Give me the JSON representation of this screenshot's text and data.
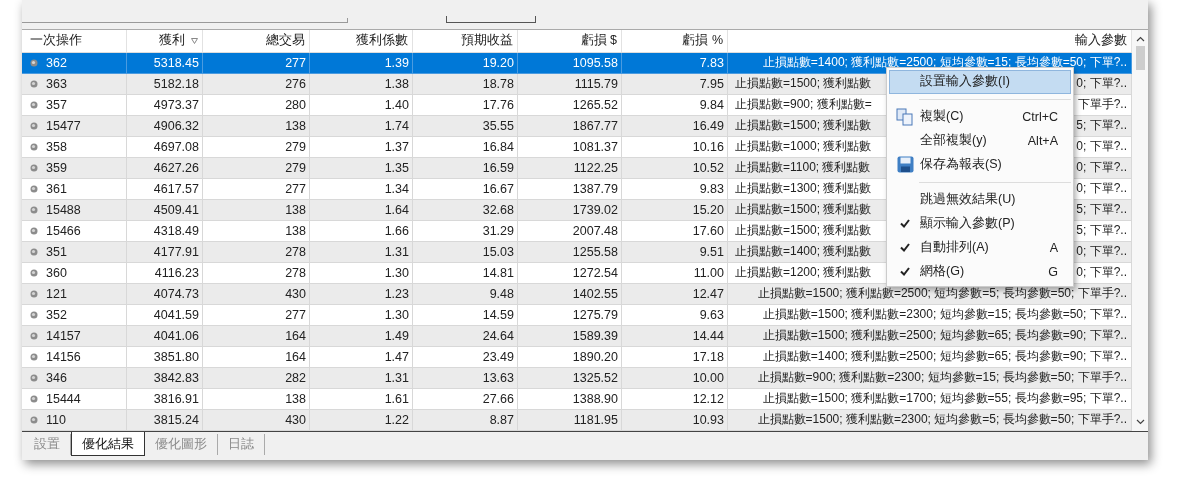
{
  "table": {
    "columns": [
      {
        "label": "一次操作",
        "sorted": false
      },
      {
        "label": "獲利",
        "sorted": true
      },
      {
        "label": "總交易",
        "sorted": false
      },
      {
        "label": "獲利係數",
        "sorted": false
      },
      {
        "label": "預期收益",
        "sorted": false
      },
      {
        "label": "虧損 $",
        "sorted": false
      },
      {
        "label": "虧損 %",
        "sorted": false
      },
      {
        "label": "輸入參數",
        "sorted": false
      }
    ],
    "rows": [
      {
        "selected": true,
        "cells": [
          "362",
          "5318.45",
          "277",
          "1.39",
          "19.20",
          "1095.58",
          "7.83"
        ],
        "params": "止損點數=1400; 獲利點數=2500; 短均參數=15; 長均參數=50; 下單?.."
      },
      {
        "selected": false,
        "cells": [
          "363",
          "5182.18",
          "276",
          "1.38",
          "18.78",
          "1115.79",
          "7.95"
        ],
        "params_left": "止損點數=1500; 獲利點數",
        "params_right": "0; 下單?.."
      },
      {
        "selected": false,
        "cells": [
          "357",
          "4973.37",
          "280",
          "1.40",
          "17.76",
          "1265.52",
          "9.84"
        ],
        "params_left": "止損點數=900; 獲利點數=",
        "params_right": "下單手?.."
      },
      {
        "selected": false,
        "cells": [
          "15477",
          "4906.32",
          "138",
          "1.74",
          "35.55",
          "1867.77",
          "16.49"
        ],
        "params_left": "止損點數=1500; 獲利點數",
        "params_right": "5; 下單?.."
      },
      {
        "selected": false,
        "cells": [
          "358",
          "4697.08",
          "279",
          "1.37",
          "16.84",
          "1081.37",
          "10.16"
        ],
        "params_left": "止損點數=1000; 獲利點數",
        "params_right": "0; 下單?.."
      },
      {
        "selected": false,
        "cells": [
          "359",
          "4627.26",
          "279",
          "1.35",
          "16.59",
          "1122.25",
          "10.52"
        ],
        "params_left": "止損點數=1100; 獲利點數",
        "params_right": "0; 下單?.."
      },
      {
        "selected": false,
        "cells": [
          "361",
          "4617.57",
          "277",
          "1.34",
          "16.67",
          "1387.79",
          "9.83"
        ],
        "params_left": "止損點數=1300; 獲利點數",
        "params_right": "0; 下單?.."
      },
      {
        "selected": false,
        "cells": [
          "15488",
          "4509.41",
          "138",
          "1.64",
          "32.68",
          "1739.02",
          "15.20"
        ],
        "params_left": "止損點數=1500; 獲利點數",
        "params_right": "5; 下單?.."
      },
      {
        "selected": false,
        "cells": [
          "15466",
          "4318.49",
          "138",
          "1.66",
          "31.29",
          "2007.48",
          "17.60"
        ],
        "params_left": "止損點數=1500; 獲利點數",
        "params_right": "5; 下單?.."
      },
      {
        "selected": false,
        "cells": [
          "351",
          "4177.91",
          "278",
          "1.31",
          "15.03",
          "1255.58",
          "9.51"
        ],
        "params_left": "止損點數=1400; 獲利點數",
        "params_right": "0; 下單?.."
      },
      {
        "selected": false,
        "cells": [
          "360",
          "4116.23",
          "278",
          "1.30",
          "14.81",
          "1272.54",
          "11.00"
        ],
        "params_left": "止損點數=1200; 獲利點數",
        "params_right": "0; 下單?.."
      },
      {
        "selected": false,
        "cells": [
          "121",
          "4074.73",
          "430",
          "1.23",
          "9.48",
          "1402.55",
          "12.47"
        ],
        "params": "止損點數=1500; 獲利點數=2500; 短均參數=5; 長均參數=50; 下單手?.."
      },
      {
        "selected": false,
        "cells": [
          "352",
          "4041.59",
          "277",
          "1.30",
          "14.59",
          "1275.79",
          "9.63"
        ],
        "params": "止損點數=1500; 獲利點數=2300; 短均參數=15; 長均參數=50; 下單?.."
      },
      {
        "selected": false,
        "cells": [
          "14157",
          "4041.06",
          "164",
          "1.49",
          "24.64",
          "1589.39",
          "14.44"
        ],
        "params": "止損點數=1500; 獲利點數=2500; 短均參數=65; 長均參數=90; 下單?.."
      },
      {
        "selected": false,
        "cells": [
          "14156",
          "3851.80",
          "164",
          "1.47",
          "23.49",
          "1890.20",
          "17.18"
        ],
        "params": "止損點數=1400; 獲利點數=2500; 短均參數=65; 長均參數=90; 下單?.."
      },
      {
        "selected": false,
        "cells": [
          "346",
          "3842.83",
          "282",
          "1.31",
          "13.63",
          "1325.52",
          "10.00"
        ],
        "params": "止損點數=900; 獲利點數=2300; 短均參數=15; 長均參數=50; 下單手?.."
      },
      {
        "selected": false,
        "cells": [
          "15444",
          "3816.91",
          "138",
          "1.61",
          "27.66",
          "1388.90",
          "12.12"
        ],
        "params": "止損點數=1500; 獲利點數=1700; 短均參數=55; 長均參數=95; 下單?.."
      },
      {
        "selected": false,
        "cells": [
          "110",
          "3815.24",
          "430",
          "1.22",
          "8.87",
          "1181.95",
          "10.93"
        ],
        "params": "止損點數=1500; 獲利點數=2300; 短均參數=5; 長均參數=50; 下單手?.."
      }
    ]
  },
  "context_menu": [
    {
      "kind": "item",
      "label": "設置輸入參數(I)",
      "selected": true,
      "checked": false
    },
    {
      "kind": "separator"
    },
    {
      "kind": "copy",
      "label": "複製(C)",
      "shortcut": "Ctrl+C",
      "selected": false,
      "checked": false
    },
    {
      "kind": "item",
      "label": "全部複製(y)",
      "shortcut": "Alt+A",
      "selected": false,
      "checked": false
    },
    {
      "kind": "save",
      "label": "保存為報表(S)",
      "selected": false,
      "checked": false
    },
    {
      "kind": "separator"
    },
    {
      "kind": "item",
      "label": "跳過無效結果(U)",
      "selected": false,
      "checked": false
    },
    {
      "kind": "item",
      "label": "顯示輸入參數(P)",
      "selected": false,
      "checked": true
    },
    {
      "kind": "item",
      "label": "自動排列(A)",
      "shortcut": "A",
      "selected": false,
      "checked": true
    },
    {
      "kind": "item",
      "label": "網格(G)",
      "shortcut": "G",
      "selected": false,
      "checked": true
    }
  ],
  "tabs": [
    {
      "label": "設置",
      "selected": false
    },
    {
      "label": "優化結果",
      "selected": true
    },
    {
      "label": "優化圖形",
      "selected": false
    },
    {
      "label": "日誌",
      "selected": false
    }
  ]
}
